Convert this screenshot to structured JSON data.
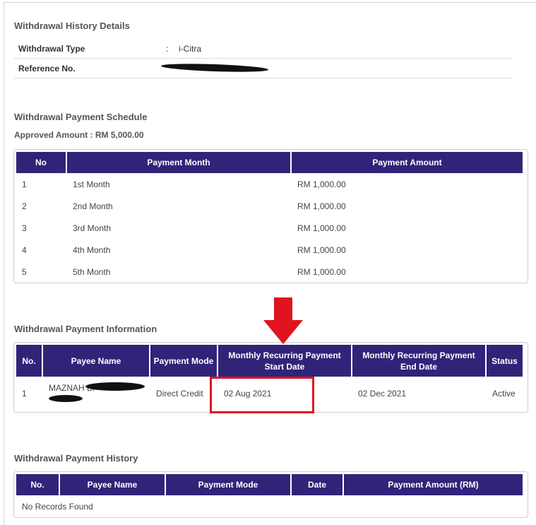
{
  "details": {
    "title": "Withdrawal History Details",
    "rows": [
      {
        "label": "Withdrawal Type",
        "separator": ":",
        "value": "i-Citra"
      },
      {
        "label": "Reference No.",
        "separator": ":",
        "value": "[redacted]"
      }
    ]
  },
  "schedule": {
    "title": "Withdrawal Payment Schedule",
    "approved_amount": "Approved Amount : RM 5,000.00",
    "headers": [
      "No",
      "Payment Month",
      "Payment Amount"
    ],
    "rows": [
      [
        "1",
        "1st Month",
        "RM 1,000.00"
      ],
      [
        "2",
        "2nd Month",
        "RM 1,000.00"
      ],
      [
        "3",
        "3rd Month",
        "RM 1,000.00"
      ],
      [
        "4",
        "4th Month",
        "RM 1,000.00"
      ],
      [
        "5",
        "5th Month",
        "RM 1,000.00"
      ]
    ]
  },
  "information": {
    "title": "Withdrawal Payment Information",
    "headers": [
      "No.",
      "Payee Name",
      "Payment Mode",
      "Monthly Recurring Payment Start Date",
      "Monthly Recurring Payment End Date",
      "Status"
    ],
    "rows": [
      [
        "1",
        "MAZNAH BI[redacted]",
        "Direct Credit",
        "02 Aug 2021",
        "02 Dec 2021",
        "Active"
      ]
    ],
    "annotation": {
      "type": "red-arrow-and-box",
      "target": "Monthly Recurring Payment Start Date",
      "color": "#e0141e"
    }
  },
  "history": {
    "title": "Withdrawal Payment History",
    "headers": [
      "No.",
      "Payee Name",
      "Payment Mode",
      "Date",
      "Payment Amount (RM)"
    ],
    "empty_message": "No Records Found"
  },
  "colors": {
    "header_bg": "#302479",
    "header_text": "#ffffff",
    "annotation": "#e0141e"
  }
}
